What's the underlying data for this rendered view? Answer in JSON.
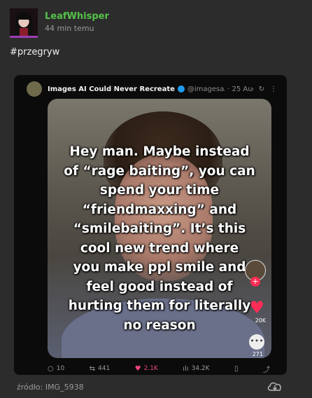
{
  "post": {
    "username": "LeafWhisper",
    "time": "44 min temu",
    "tag": "#przegryw",
    "source": "źródło: IMG_5938"
  },
  "tweet": {
    "name": "Images AI Could Never Recreate",
    "handle": "@imagesa...",
    "date": "· 25 Aug",
    "overlay_lines": [
      "Hey man. Maybe instead",
      "of “rage baiting”, you can",
      "spend your time",
      "“friendmaxxing” and",
      "“smilebaiting”. It’s this",
      "cool new trend where",
      "you make ppl smile and",
      "feel good instead of",
      "hurting them for literally",
      "no reason"
    ],
    "side": {
      "heart_count": "20K",
      "comment_count": "271"
    },
    "actions": {
      "replies": "10",
      "reposts": "441",
      "likes": "2.1K",
      "views": "34.2K"
    }
  },
  "colors": {
    "username": "#55c24a",
    "like": "#f0457a",
    "avatar_underline": "#9b3fb3",
    "verified": "#1d9bf0"
  }
}
